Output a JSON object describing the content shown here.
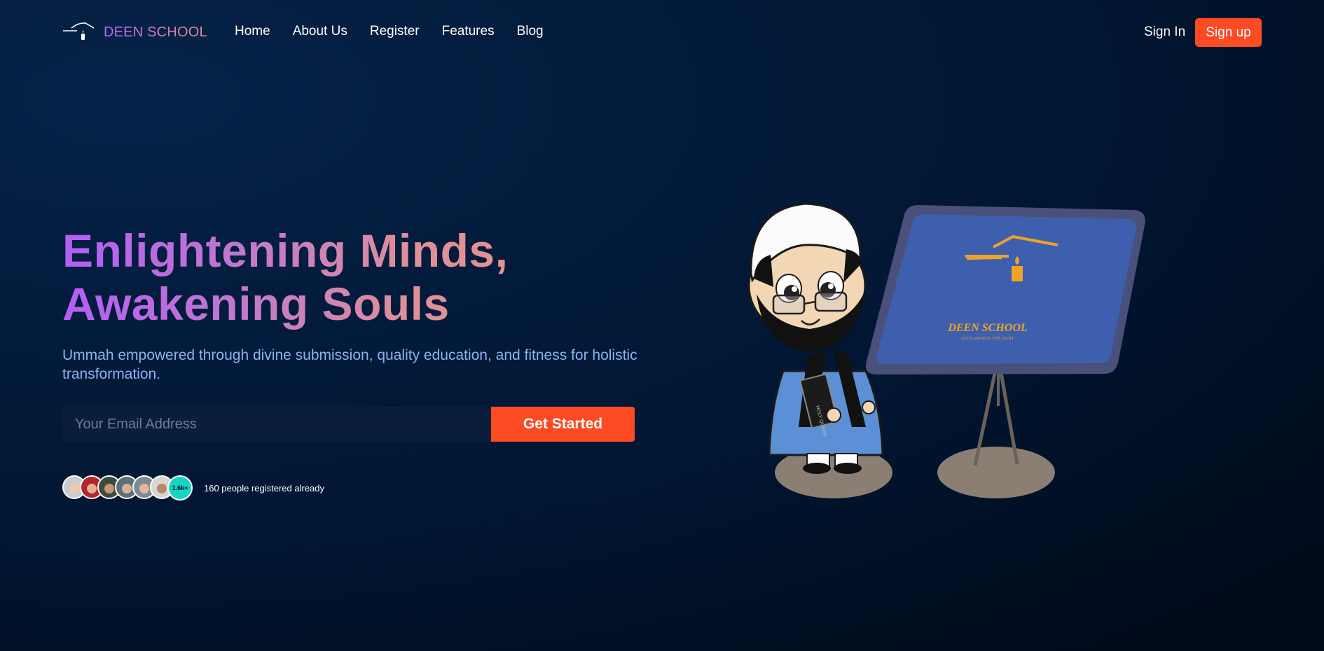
{
  "brand": {
    "name": "DEEN SCHOOL",
    "accent": "#ff4b23",
    "gradient_start": "#b15ff6",
    "gradient_end": "#e5948c"
  },
  "nav": {
    "links": [
      "Home",
      "About Us",
      "Register",
      "Features",
      "Blog"
    ],
    "sign_in": "Sign In",
    "sign_up": "Sign up"
  },
  "hero": {
    "title_line1": "Enlightening Minds,",
    "title_line2": "Awakening Souls",
    "subtitle": "Ummah empowered through divine submission, quality education, and fitness for holistic transformation.",
    "email_placeholder": "Your Email Address",
    "cta": "Get Started",
    "registered_badge": "1.6k+",
    "registered_text": "160 people registered already"
  },
  "illustration": {
    "board_title": "DEEN SCHOOL",
    "board_tagline": "LET'S AWAKEN THE LIGHT",
    "book_spine": "HOLY QURAN"
  },
  "icons": [
    "logo-lamp-icon"
  ]
}
